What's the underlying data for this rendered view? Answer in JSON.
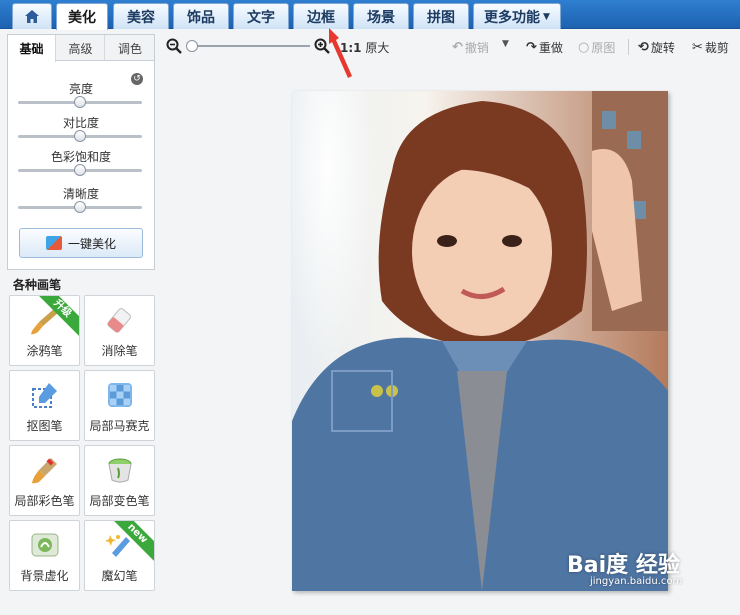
{
  "top_tabs": [
    {
      "label": "美化",
      "active": true
    },
    {
      "label": "美容",
      "active": false
    },
    {
      "label": "饰品",
      "active": false
    },
    {
      "label": "文字",
      "active": false
    },
    {
      "label": "边框",
      "active": false
    },
    {
      "label": "场景",
      "active": false
    },
    {
      "label": "拼图",
      "active": false
    },
    {
      "label": "更多功能",
      "active": false
    }
  ],
  "toolbar": {
    "zoom_value_fraction": 0.0,
    "original_size_prefix": "1:1",
    "original_size_label": "原大",
    "undo_label": "撤销",
    "redo_label": "重做",
    "original_label": "原图",
    "rotate_label": "旋转",
    "crop_label": "裁剪"
  },
  "panel": {
    "subtabs": [
      {
        "label": "基础",
        "active": true
      },
      {
        "label": "高级",
        "active": false
      },
      {
        "label": "调色",
        "active": false
      }
    ],
    "sliders": [
      {
        "label": "亮度",
        "value": 0.5
      },
      {
        "label": "对比度",
        "value": 0.5
      },
      {
        "label": "色彩饱和度",
        "value": 0.5
      },
      {
        "label": "清晰度",
        "value": 0.5
      }
    ],
    "auto_button_label": "一键美化"
  },
  "brushes": {
    "title": "各种画笔",
    "items": [
      {
        "label": "涂鸦笔",
        "badge": "升级",
        "icon": "paintbrush-icon"
      },
      {
        "label": "消除笔",
        "badge": "",
        "icon": "eraser-icon"
      },
      {
        "label": "抠图笔",
        "badge": "",
        "icon": "cutout-pen-icon"
      },
      {
        "label": "局部马赛克",
        "badge": "",
        "icon": "mosaic-icon"
      },
      {
        "label": "局部彩色笔",
        "badge": "",
        "icon": "color-brush-icon"
      },
      {
        "label": "局部变色笔",
        "badge": "",
        "icon": "paint-bucket-icon"
      },
      {
        "label": "背景虚化",
        "badge": "",
        "icon": "blur-background-icon"
      },
      {
        "label": "魔幻笔",
        "badge": "new",
        "icon": "magic-wand-icon"
      }
    ]
  },
  "watermark": {
    "text": "Bai度 经验",
    "sub": "jingyan.baidu.com"
  },
  "colors": {
    "topbar": "#1d62b0",
    "accent_red": "#e8372e",
    "ribbon_green": "#3aa83a"
  }
}
